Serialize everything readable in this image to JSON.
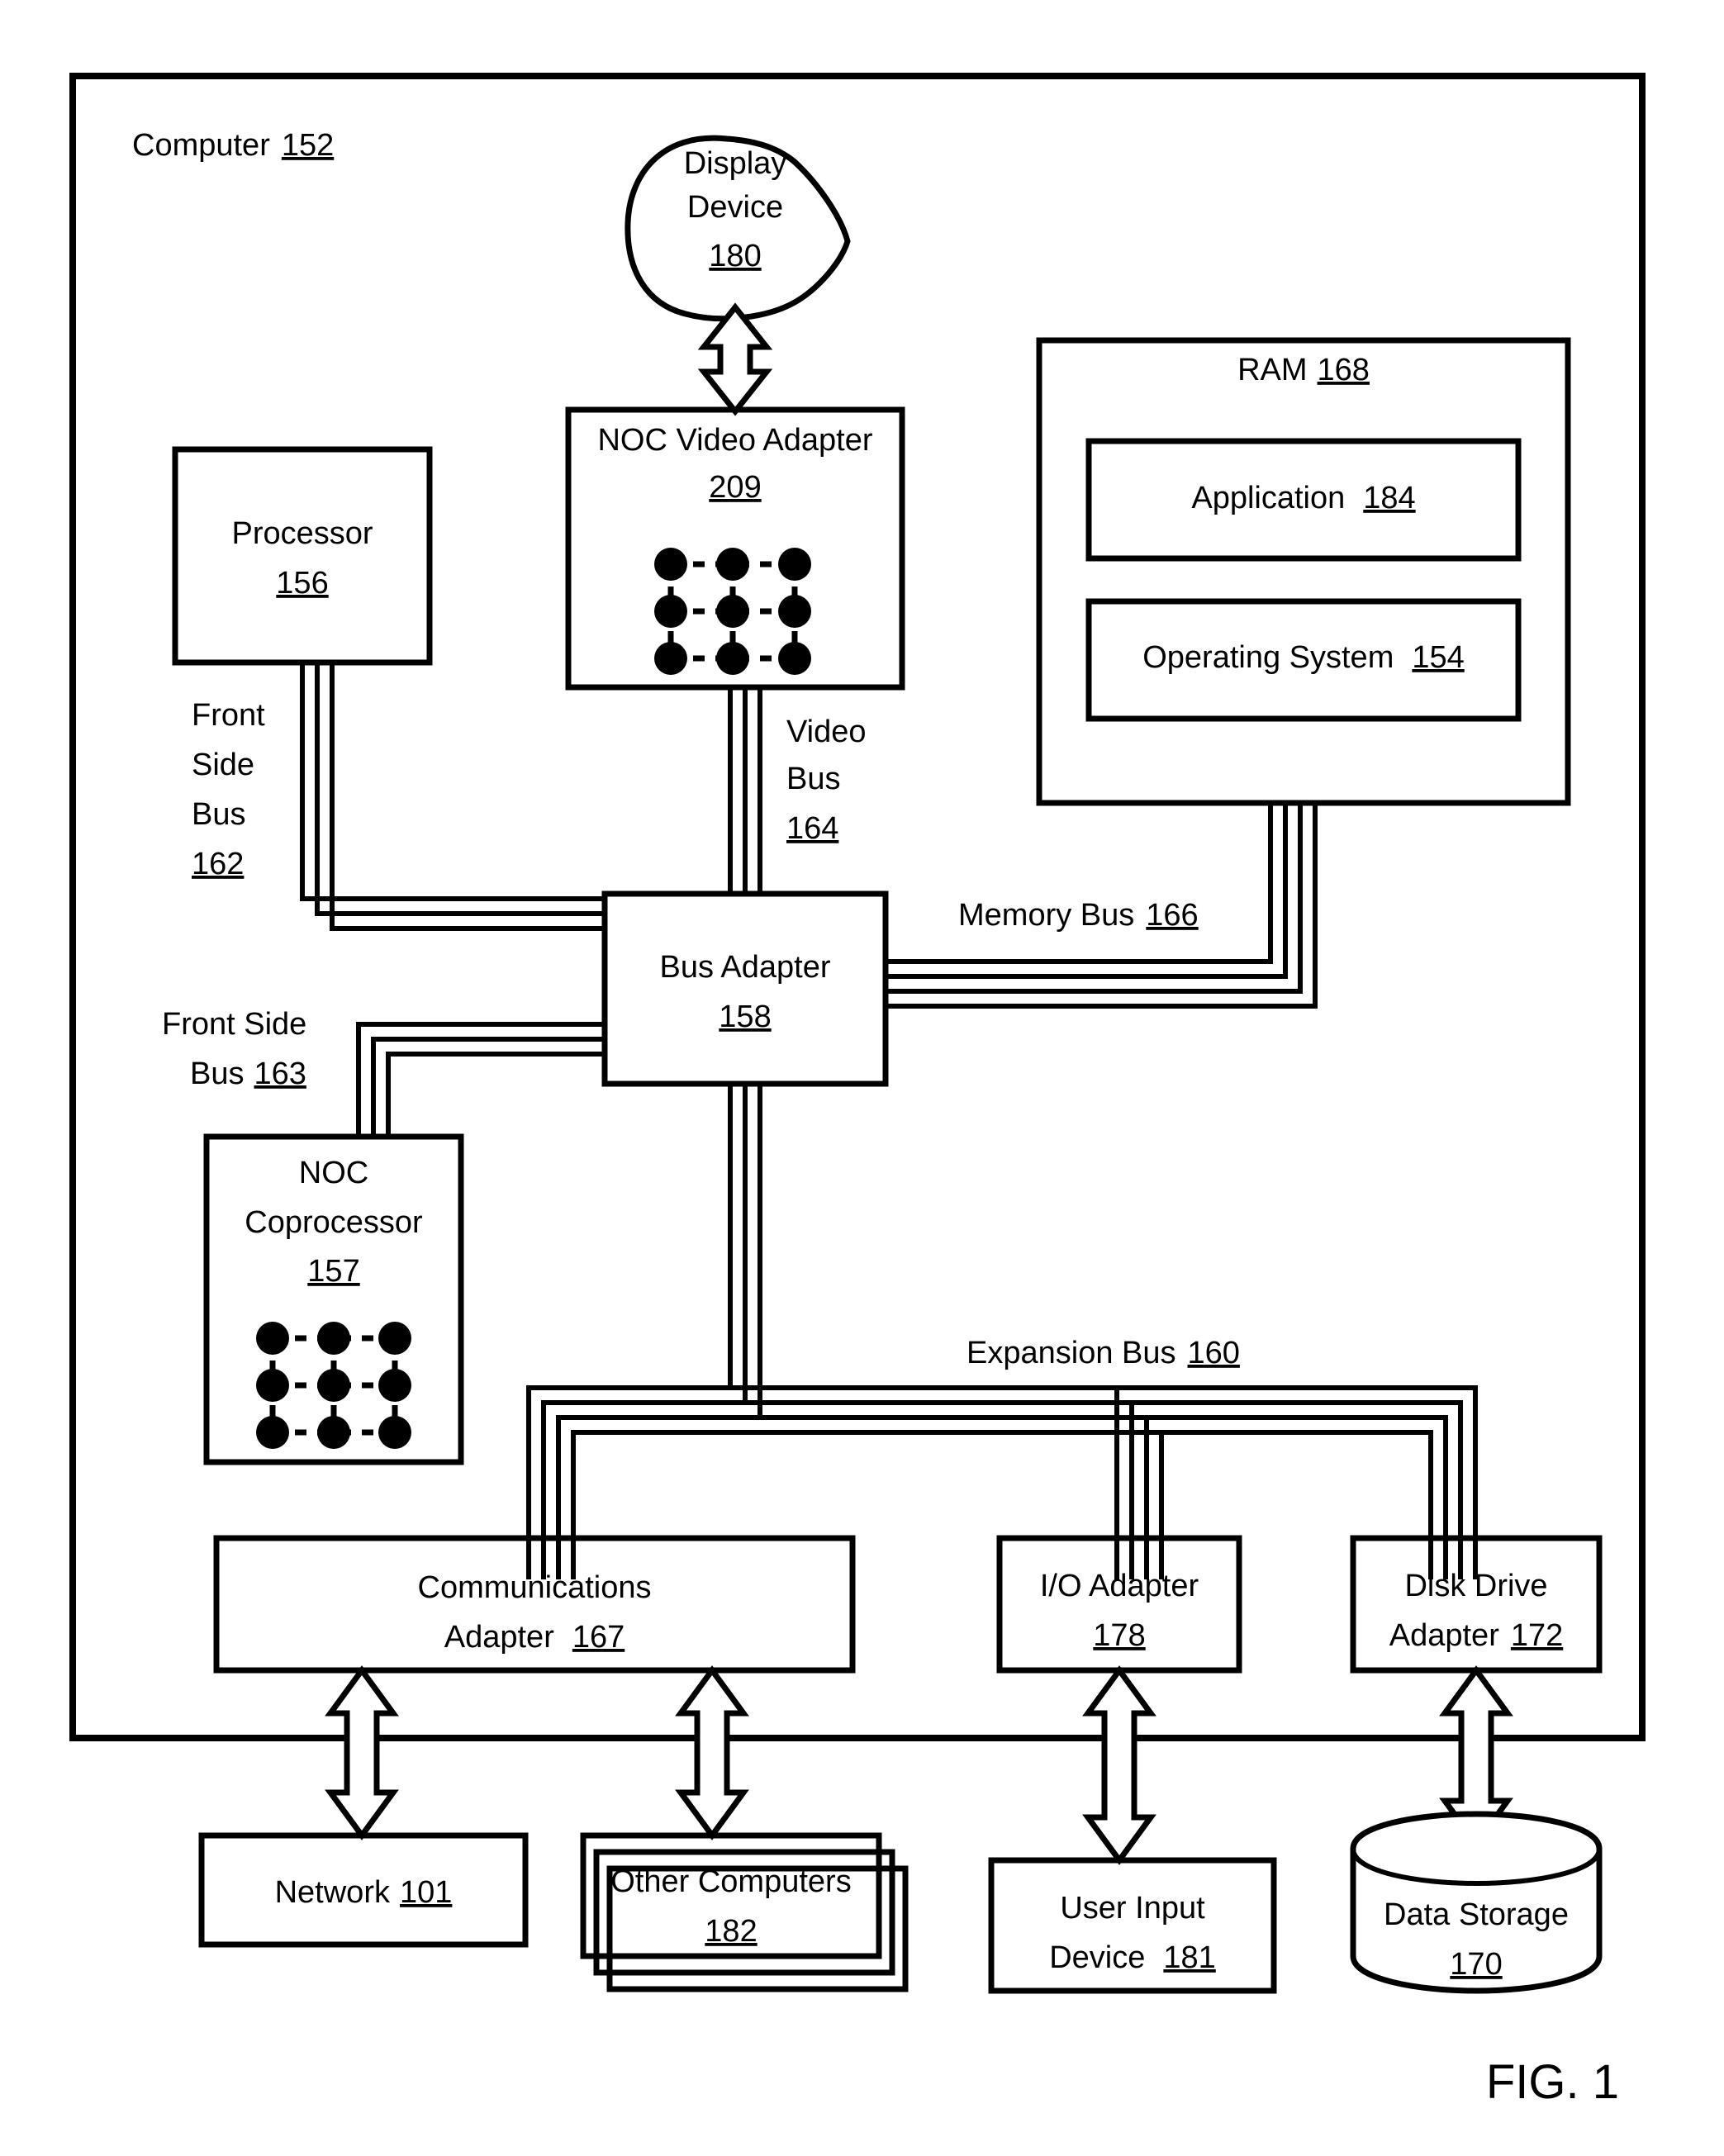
{
  "figure": {
    "label": "FIG. 1",
    "outer_container": {
      "title": "Computer",
      "ref": "152"
    }
  },
  "nodes": {
    "display_device": {
      "line1": "Display",
      "line2": "Device",
      "ref": "180",
      "shape": "blob"
    },
    "noc_video_adapter": {
      "title": "NOC Video Adapter",
      "ref": "209",
      "shape": "rect-with-mesh",
      "mesh": {
        "rows": 3,
        "cols": 3
      }
    },
    "processor": {
      "title": "Processor",
      "ref": "156",
      "shape": "rect"
    },
    "ram": {
      "title": "RAM",
      "ref": "168",
      "shape": "rect",
      "children": [
        {
          "title": "Application",
          "ref": "184"
        },
        {
          "title": "Operating System",
          "ref": "154"
        }
      ]
    },
    "bus_adapter": {
      "title": "Bus Adapter",
      "ref": "158",
      "shape": "rect"
    },
    "noc_coprocessor": {
      "line1": "NOC",
      "line2": "Coprocessor",
      "ref": "157",
      "shape": "rect-with-mesh",
      "mesh": {
        "rows": 3,
        "cols": 3
      }
    },
    "communications_adapter": {
      "line1": "Communications",
      "line2": "Adapter",
      "ref": "167",
      "shape": "rect"
    },
    "io_adapter": {
      "title": "I/O Adapter",
      "ref": "178",
      "shape": "rect"
    },
    "disk_drive_adapter": {
      "line1": "Disk Drive",
      "line2": "Adapter",
      "ref": "172",
      "shape": "rect"
    },
    "network": {
      "title": "Network",
      "ref": "101",
      "shape": "rect"
    },
    "other_computers": {
      "title": "Other Computers",
      "ref": "182",
      "shape": "stacked-rect"
    },
    "user_input_device": {
      "line1": "User Input",
      "line2": "Device",
      "ref": "181",
      "shape": "rect"
    },
    "data_storage": {
      "title": "Data Storage",
      "ref": "170",
      "shape": "cylinder"
    }
  },
  "buses": {
    "front_side_bus_162": {
      "line1": "Front",
      "line2": "Side",
      "line3": "Bus",
      "ref": "162"
    },
    "front_side_bus_163": {
      "line1": "Front Side",
      "line2": "Bus",
      "ref": "163"
    },
    "video_bus_164": {
      "line1": "Video",
      "line2": "Bus",
      "ref": "164"
    },
    "memory_bus_166": {
      "title": "Memory Bus",
      "ref": "166"
    },
    "expansion_bus_160": {
      "title": "Expansion Bus",
      "ref": "160"
    }
  },
  "colors": {
    "stroke": "#000000",
    "background": "#ffffff"
  }
}
